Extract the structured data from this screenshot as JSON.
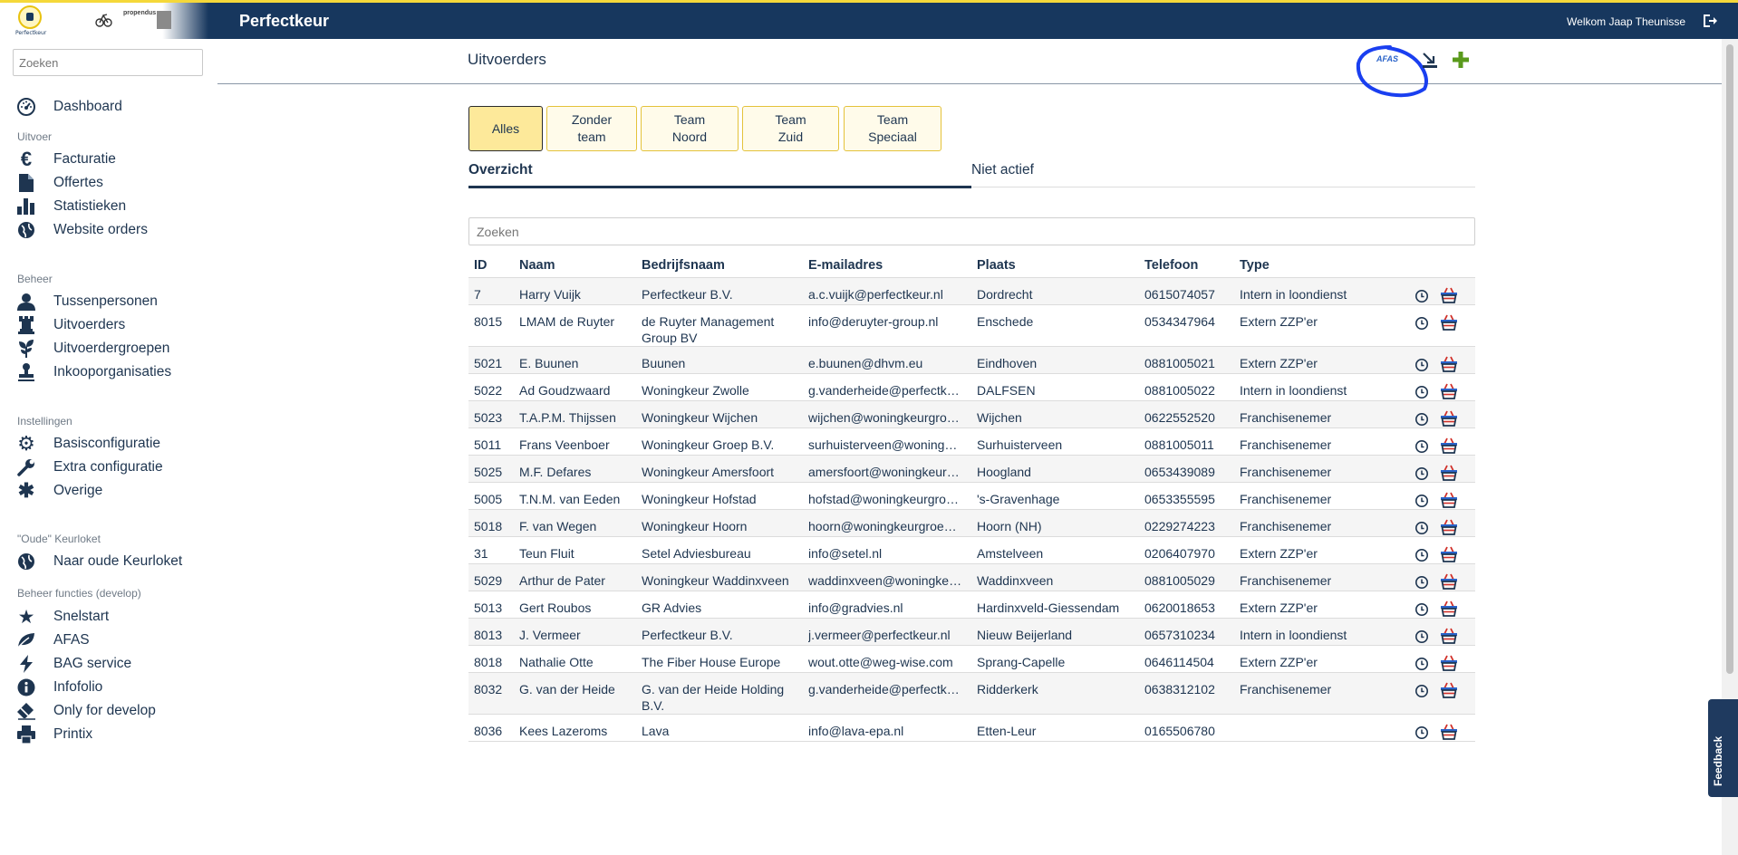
{
  "header": {
    "app_title": "Perfectkeur",
    "welcome": "Welkom Jaap Theunisse",
    "logos": {
      "logo1_text": "Perfectkeur",
      "logo3_text": "propendus"
    }
  },
  "sidebar": {
    "search_placeholder": "Zoeken",
    "dashboard": "Dashboard",
    "sections": {
      "uitvoer": "Uitvoer",
      "beheer": "Beheer",
      "instellingen": "Instellingen",
      "oude": "\"Oude\" Keurloket",
      "develop": "Beheer functies (develop)"
    },
    "items": {
      "facturatie": "Facturatie",
      "offertes": "Offertes",
      "statistieken": "Statistieken",
      "website_orders": "Website orders",
      "tussenpersonen": "Tussenpersonen",
      "uitvoerders": "Uitvoerders",
      "uitvoerdergroepen": "Uitvoerdergroepen",
      "inkooporganisaties": "Inkooporganisaties",
      "basisconfiguratie": "Basisconfiguratie",
      "extra_configuratie": "Extra configuratie",
      "overige": "Overige",
      "naar_oude_keurloket": "Naar oude Keurloket",
      "snelstart": "Snelstart",
      "afas": "AFAS",
      "bag_service": "BAG service",
      "infofolio": "Infofolio",
      "only_for_develop": "Only for develop",
      "printix": "Printix"
    }
  },
  "main": {
    "page_title": "Uitvoerders",
    "afas_label": "AFAS",
    "filters": {
      "alles": "Alles",
      "zonder_team_1": "Zonder",
      "zonder_team_2": "team",
      "noord_1": "Team",
      "noord_2": "Noord",
      "zuid_1": "Team",
      "zuid_2": "Zuid",
      "speciaal_1": "Team",
      "speciaal_2": "Speciaal"
    },
    "tabs": {
      "overzicht": "Overzicht",
      "niet_actief": "Niet actief"
    },
    "table_search_placeholder": "Zoeken",
    "columns": {
      "id": "ID",
      "naam": "Naam",
      "bedrijfsnaam": "Bedrijfsnaam",
      "email": "E-mailadres",
      "plaats": "Plaats",
      "telefoon": "Telefoon",
      "type": "Type"
    },
    "rows": [
      {
        "id": "7",
        "naam": "Harry Vuijk",
        "bedrijf": "Perfectkeur B.V.",
        "email": "a.c.vuijk@perfectkeur.nl",
        "plaats": "Dordrecht",
        "tel": "0615074057",
        "type": "Intern in loondienst"
      },
      {
        "id": "8015",
        "naam": "LMAM de Ruyter",
        "bedrijf": "de Ruyter Management Group BV",
        "email": "info@deruyter-group.nl",
        "plaats": "Enschede",
        "tel": "0534347964",
        "type": "Extern ZZP'er"
      },
      {
        "id": "5021",
        "naam": "E. Buunen",
        "bedrijf": "Buunen",
        "email": "e.buunen@dhvm.eu",
        "plaats": "Eindhoven",
        "tel": "0881005021",
        "type": "Extern ZZP'er"
      },
      {
        "id": "5022",
        "naam": "Ad Goudzwaard",
        "bedrijf": "Woningkeur Zwolle",
        "email": "g.vanderheide@perfectkeur.nl",
        "plaats": "DALFSEN",
        "tel": "0881005022",
        "type": "Intern in loondienst"
      },
      {
        "id": "5023",
        "naam": "T.A.P.M. Thijssen",
        "bedrijf": "Woningkeur Wijchen",
        "email": "wijchen@woningkeurgroep.nl",
        "plaats": "Wijchen",
        "tel": "0622552520",
        "type": "Franchisenemer"
      },
      {
        "id": "5011",
        "naam": "Frans Veenboer",
        "bedrijf": "Woningkeur Groep B.V.",
        "email": "surhuisterveen@woningkeurgroep.nl",
        "plaats": "Surhuisterveen",
        "tel": "0881005011",
        "type": "Franchisenemer"
      },
      {
        "id": "5025",
        "naam": "M.F. Defares",
        "bedrijf": "Woningkeur Amersfoort",
        "email": "amersfoort@woningkeurgroep.nl",
        "plaats": "Hoogland",
        "tel": "0653439089",
        "type": "Franchisenemer"
      },
      {
        "id": "5005",
        "naam": "T.N.M. van Eeden",
        "bedrijf": "Woningkeur Hofstad",
        "email": "hofstad@woningkeurgroep.nl",
        "plaats": "'s-Gravenhage",
        "tel": "0653355595",
        "type": "Franchisenemer"
      },
      {
        "id": "5018",
        "naam": "F. van Wegen",
        "bedrijf": "Woningkeur Hoorn",
        "email": "hoorn@woningkeurgroep.nl",
        "plaats": "Hoorn (NH)",
        "tel": "0229274223",
        "type": "Franchisenemer"
      },
      {
        "id": "31",
        "naam": "Teun Fluit",
        "bedrijf": "Setel Adviesbureau",
        "email": "info@setel.nl",
        "plaats": "Amstelveen",
        "tel": "0206407970",
        "type": "Extern ZZP'er"
      },
      {
        "id": "5029",
        "naam": "Arthur de Pater",
        "bedrijf": "Woningkeur Waddinxveen",
        "email": "waddinxveen@woningkeurgroep.nl",
        "plaats": "Waddinxveen",
        "tel": "0881005029",
        "type": "Franchisenemer"
      },
      {
        "id": "5013",
        "naam": "Gert Roubos",
        "bedrijf": "GR Advies",
        "email": "info@gradvies.nl",
        "plaats": "Hardinxveld-Giessendam",
        "tel": "0620018653",
        "type": "Extern ZZP'er"
      },
      {
        "id": "8013",
        "naam": "J. Vermeer",
        "bedrijf": "Perfectkeur B.V.",
        "email": "j.vermeer@perfectkeur.nl",
        "plaats": "Nieuw Beijerland",
        "tel": "0657310234",
        "type": "Intern in loondienst"
      },
      {
        "id": "8018",
        "naam": "Nathalie Otte",
        "bedrijf": "The Fiber House Europe",
        "email": "wout.otte@weg-wise.com",
        "plaats": "Sprang-Capelle",
        "tel": "0646114504",
        "type": "Extern ZZP'er"
      },
      {
        "id": "8032",
        "naam": "G. van der Heide",
        "bedrijf": "G. van der Heide Holding B.V.",
        "email": "g.vanderheide@perfectkeur.nl",
        "plaats": "Ridderkerk",
        "tel": "0638312102",
        "type": "Franchisenemer"
      },
      {
        "id": "8036",
        "naam": "Kees Lazeroms",
        "bedrijf": "Lava",
        "email": "info@lava-epa.nl",
        "plaats": "Etten-Leur",
        "tel": "0165506780",
        "type": ""
      }
    ]
  },
  "feedback": "Feedback",
  "colors": {
    "navy": "#17375e",
    "accent_yellow": "#f5d83a",
    "filter_active": "#fde99a",
    "afas_blue": "#2a63c9",
    "add_green": "#5a9a1c"
  }
}
